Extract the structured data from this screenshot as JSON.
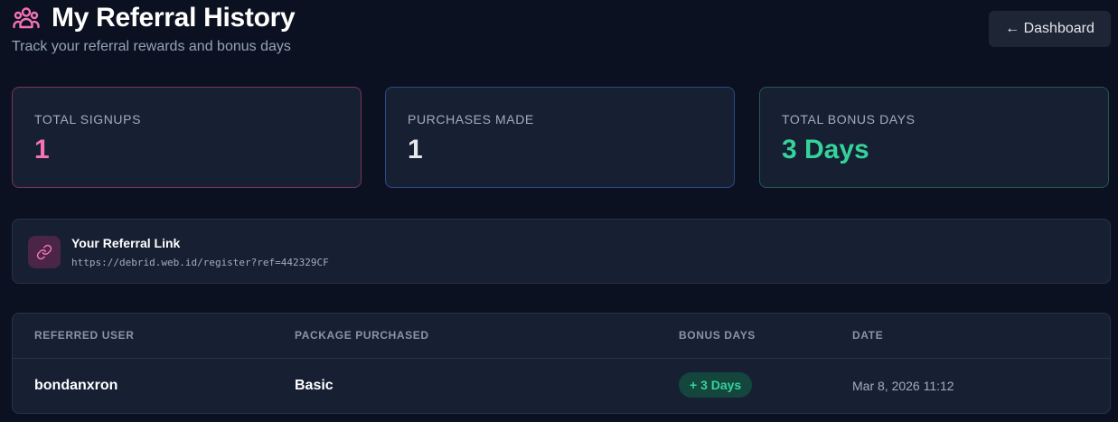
{
  "header": {
    "title": "My Referral History",
    "subtitle": "Track your referral rewards and bonus days",
    "back_button_label": "← Dashboard",
    "title_icon": "users-icon"
  },
  "stats": [
    {
      "label": "TOTAL SIGNUPS",
      "value": "1",
      "accent": "#f472b6"
    },
    {
      "label": "PURCHASES MADE",
      "value": "1",
      "accent": "#e5e7eb"
    },
    {
      "label": "TOTAL BONUS DAYS",
      "value": "3 Days",
      "accent": "#34d399"
    }
  ],
  "referral_link": {
    "title": "Your Referral Link",
    "url": "https://debrid.web.id/register?ref=442329CF",
    "icon": "link-icon"
  },
  "table": {
    "headers": [
      "REFERRED USER",
      "PACKAGE PURCHASED",
      "BONUS DAYS",
      "DATE"
    ],
    "rows": [
      {
        "user": "bondanxron",
        "package": "Basic",
        "bonus": "+ 3 Days",
        "date": "Mar 8, 2026 11:12"
      }
    ]
  },
  "colors": {
    "background": "#0b1120",
    "card": "#172033",
    "pink": "#f472b6",
    "green": "#34d399"
  }
}
